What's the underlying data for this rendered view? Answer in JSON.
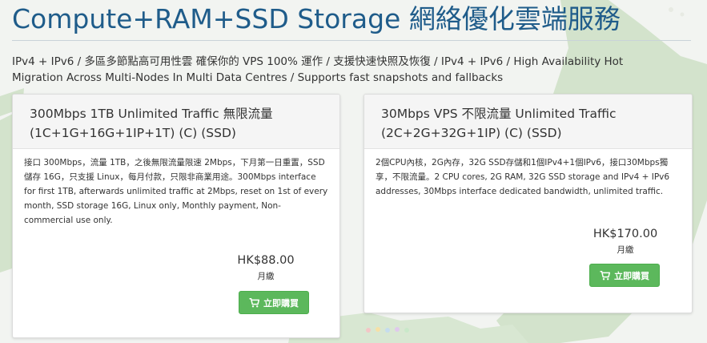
{
  "page": {
    "title": "Compute+RAM+SSD Storage 網絡優化雲端服務",
    "subtitle": "IPv4 + IPv6 / 多區多節點高可用性雲 確保你的 VPS 100% 運作 / 支援快速快照及恢復 / IPv4 + IPv6 / High Availability Hot Migration Across Multi-Nodes In Multi Data Centres / Supports fast snapshots and fallbacks"
  },
  "plans": [
    {
      "name_line1": "300Mbps 1TB Unlimited Traffic 無限流量",
      "name_line2": "(1C+1G+16G+1IP+1T) (C) (SSD)",
      "description": "接口 300Mbps，流量 1TB，之後無限流量限速 2Mbps，下月第一日重置，SSD 儲存 16G，只支援 Linux，每月付款，只限非商業用途。300Mbps interface for first 1TB, afterwards unlimited traffic at 2Mbps, reset on 1st of every month, SSD storage 16G, Linux only, Monthly payment, Non-commercial use only.",
      "price": "HK$88.00",
      "period": "月繳",
      "button_label": "立即購買",
      "button_icon": "shopping-cart-icon"
    },
    {
      "name_line1": "30Mbps VPS 不限流量 Unlimited Traffic",
      "name_line2": "(2C+2G+32G+1IP) (C) (SSD)",
      "description": "2個CPU內核，2G內存，32G SSD存儲和1個IPv4+1個IPv6，接口30Mbps獨享，不限流量。2 CPU cores, 2G RAM, 32G SSD storage and IPv4 + IPv6 addresses, 30Mbps interface dedicated bandwidth, unlimited traffic.",
      "price": "HK$170.00",
      "period": "月繳",
      "button_label": "立即購買",
      "button_icon": "shopping-cart-icon"
    }
  ],
  "colors": {
    "title": "#1f5c8a",
    "button": "#5cb85c",
    "map_land": "#cfe0c9"
  }
}
